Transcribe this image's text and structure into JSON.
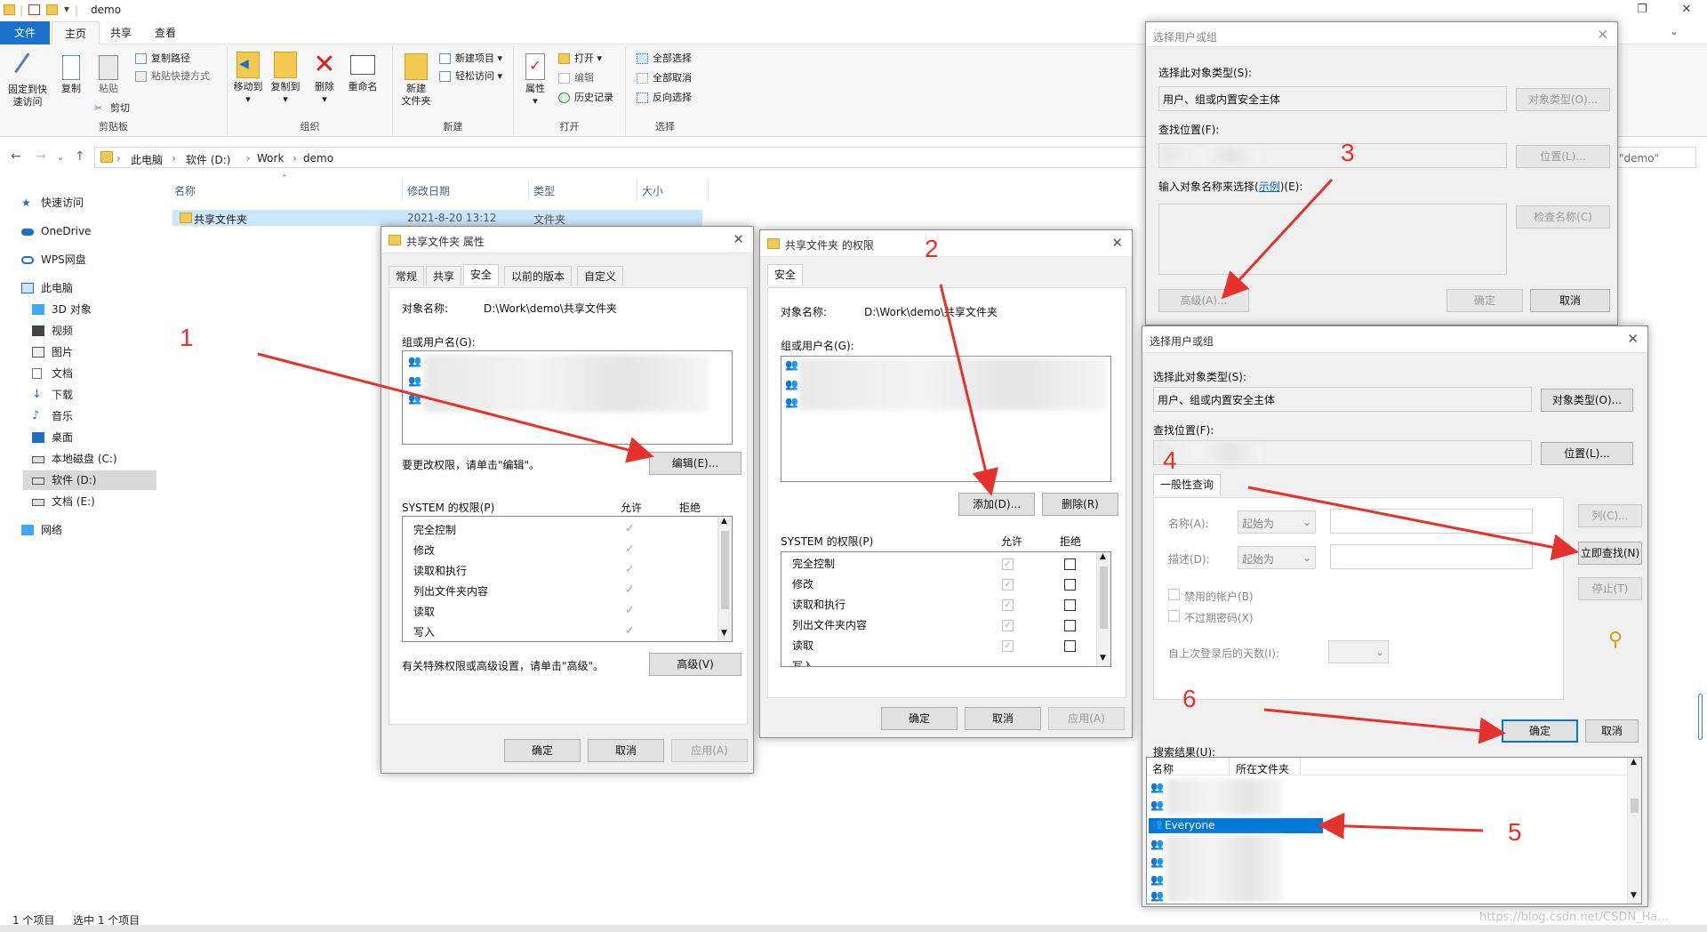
{
  "explorer": {
    "window_title": "demo",
    "tabs": [
      "文件",
      "主页",
      "共享",
      "查看"
    ],
    "ribbon": {
      "pin_quick_access": "固定到快\n速访问",
      "copy": "复制",
      "paste": "粘贴",
      "copy_path": "复制路径",
      "paste_shortcut": "粘贴快捷方式",
      "cut": "剪切",
      "group_clipboard": "剪贴板",
      "move_to": "移动到",
      "copy_to": "复制到",
      "delete": "删除",
      "rename": "重命名",
      "group_organize": "组织",
      "new_folder": "新建\n文件夹",
      "new_item": "新建项目",
      "easy_access": "轻松访问",
      "group_new": "新建",
      "properties": "属性",
      "open": "打开",
      "edit": "编辑",
      "history": "历史记录",
      "group_open": "打开",
      "select_all": "全部选择",
      "select_none": "全部取消",
      "invert_selection": "反向选择",
      "group_select": "选择"
    },
    "breadcrumb": [
      "此电脑",
      "软件 (D:)",
      "Work",
      "demo"
    ],
    "search_placeholder": "\"demo\"",
    "sidebar": [
      "快速访问",
      "OneDrive",
      "WPS网盘",
      "此电脑",
      "3D 对象",
      "视频",
      "图片",
      "文档",
      "下载",
      "音乐",
      "桌面",
      "本地磁盘 (C:)",
      "软件 (D:)",
      "文档 (E:)",
      "网络"
    ],
    "columns": [
      "名称",
      "修改日期",
      "类型",
      "大小"
    ],
    "file": {
      "name": "共享文件夹",
      "date": "2021-8-20 13:12",
      "type": "文件夹"
    },
    "status": {
      "count": "1 个项目",
      "selected": "选中 1 个项目"
    },
    "watermark": "https://blog.csdn.net/CSDN_Ha..."
  },
  "props_dialog": {
    "title": "共享文件夹 属性",
    "tabs": [
      "常规",
      "共享",
      "安全",
      "以前的版本",
      "自定义"
    ],
    "object_label": "对象名称:",
    "object_value": "D:\\Work\\demo\\共享文件夹",
    "group_label": "组或用户名(G):",
    "edit_hint": "要更改权限，请单击\"编辑\"。",
    "edit_btn": "编辑(E)...",
    "perm_label": "SYSTEM 的权限(P)",
    "allow": "允许",
    "deny": "拒绝",
    "perms": [
      "完全控制",
      "修改",
      "读取和执行",
      "列出文件夹内容",
      "读取",
      "写入"
    ],
    "adv_hint": "有关特殊权限或高级设置，请单击\"高级\"。",
    "adv_btn": "高级(V)",
    "ok": "确定",
    "cancel": "取消",
    "apply": "应用(A)"
  },
  "perm_dialog": {
    "title": "共享文件夹 的权限",
    "tab": "安全",
    "object_label": "对象名称:",
    "object_value": "D:\\Work\\demo\\共享文件夹",
    "group_label": "组或用户名(G):",
    "add_btn": "添加(D)...",
    "remove_btn": "删除(R)",
    "perm_label": "SYSTEM 的权限(P)",
    "allow": "允许",
    "deny": "拒绝",
    "perms": [
      "完全控制",
      "修改",
      "读取和执行",
      "列出文件夹内容",
      "读取",
      "写入"
    ],
    "ok": "确定",
    "cancel": "取消",
    "apply": "应用(A)"
  },
  "select_dialog_1": {
    "title": "选择用户或组",
    "type_label": "选择此对象类型(S):",
    "type_value": "用户、组或内置安全主体",
    "type_btn": "对象类型(O)...",
    "loc_label": "查找位置(F):",
    "loc_btn": "位置(L)...",
    "name_label_pre": "输入对象名称来选择(",
    "name_label_link": "示例",
    "name_label_post": ")(E):",
    "check_btn": "检查名称(C)",
    "advanced_btn": "高级(A)...",
    "ok": "确定",
    "cancel": "取消"
  },
  "select_dialog_2": {
    "title": "选择用户或组",
    "type_label": "选择此对象类型(S):",
    "type_value": "用户、组或内置安全主体",
    "type_btn": "对象类型(O)...",
    "loc_label": "查找位置(F):",
    "loc_btn": "位置(L)...",
    "tab": "一般性查询",
    "name_label": "名称(A):",
    "desc_label": "描述(D):",
    "starts_with": "起始为",
    "disabled_accounts": "禁用的帐户(B)",
    "no_expire": "不过期密码(X)",
    "days_label": "自上次登录后的天数(I):",
    "columns_btn": "列(C)...",
    "find_now_btn": "立即查找(N)",
    "stop_btn": "停止(T)",
    "ok": "确定",
    "cancel": "取消",
    "results_label": "搜索结果(U):",
    "result_cols": [
      "名称",
      "所在文件夹"
    ],
    "selected_result": "Everyone"
  },
  "annotations": [
    "1",
    "2",
    "3",
    "4",
    "5",
    "6"
  ],
  "colors": {
    "accent": "#0078d7",
    "annotation": "#e5322d",
    "selection": "#0078d7"
  }
}
